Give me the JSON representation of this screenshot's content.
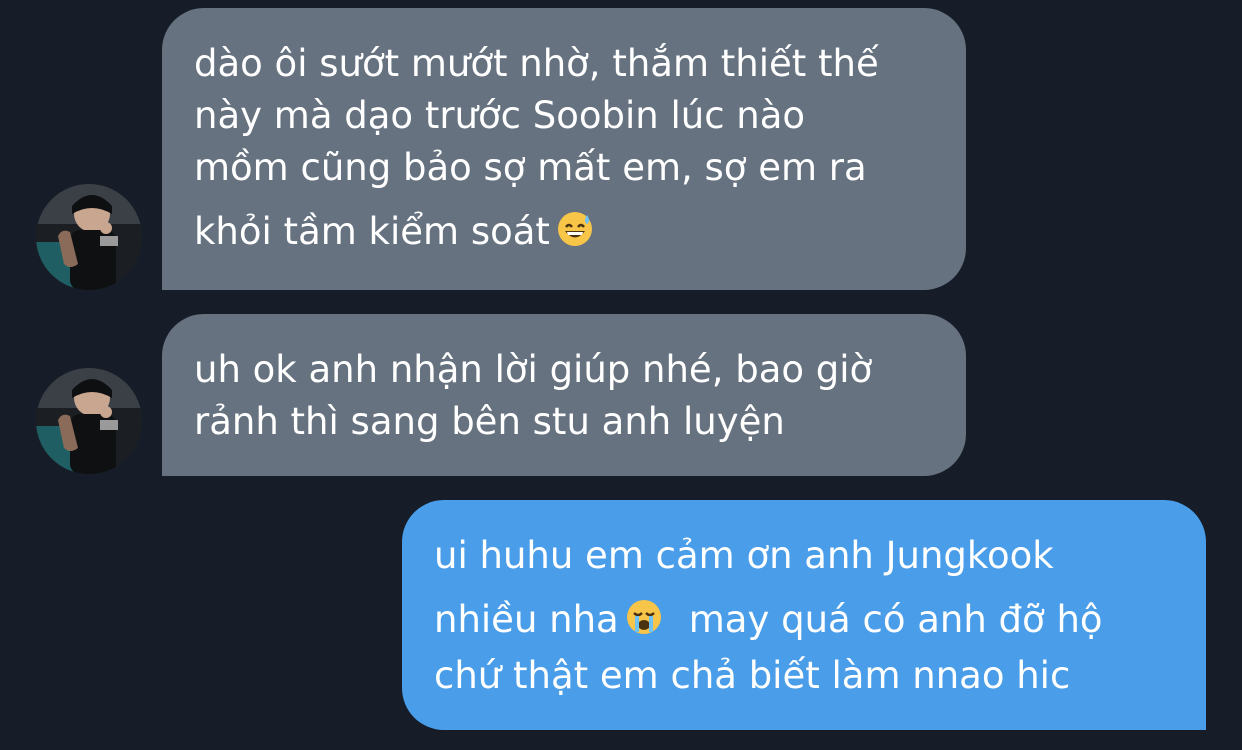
{
  "conversation": {
    "messages": [
      {
        "direction": "incoming",
        "lines": [
          "dào ôi sướt mướt nhờ, thắm thiết thế",
          "này mà dạo trước Soobin lúc nào",
          "mồm cũng bảo sợ mất em, sợ em ra",
          "khỏi tầm kiểm soát"
        ],
        "emoji": "grinning-sweat-emoji"
      },
      {
        "direction": "incoming",
        "lines": [
          "uh ok anh nhận lời giúp nhé, bao giờ",
          "rảnh thì sang bên stu anh luyện"
        ]
      },
      {
        "direction": "outgoing",
        "lines": [
          "ui huhu em cảm ơn anh Jungkook",
          "nhiều nha",
          "may quá có anh đỡ hộ",
          "chứ thật em chả biết làm nnao hic"
        ],
        "emoji": "loudly-crying-emoji"
      }
    ]
  },
  "colors": {
    "background": "#161d28",
    "incoming_bubble": "#66727f",
    "outgoing_bubble": "#4a9de8",
    "text": "#ffffff"
  }
}
